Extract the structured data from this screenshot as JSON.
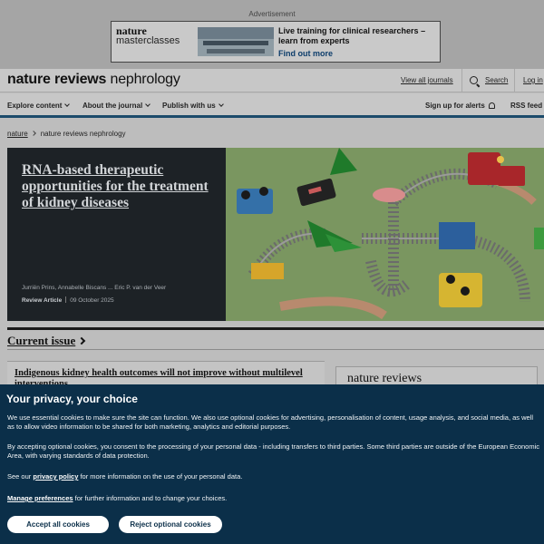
{
  "ad": {
    "label": "Advertisement",
    "brand_line1": "nature",
    "brand_line2": "masterclasses",
    "headline": "Live training for clinical researchers – learn from experts",
    "cta": "Find out more"
  },
  "header": {
    "logo_bold": "nature reviews",
    "logo_rest": " nephrology",
    "view_all": "View all journals",
    "search": "Search",
    "login": "Log in"
  },
  "nav": {
    "explore": "Explore content",
    "about": "About the journal",
    "publish": "Publish with us",
    "alerts": "Sign up for alerts",
    "rss": "RSS feed"
  },
  "breadcrumb": {
    "home": "nature",
    "current": "nature reviews nephrology"
  },
  "hero": {
    "title": "RNA-based therapeutic opportunities for the treatment of kidney diseases",
    "authors": "Jurriën Prins, Annabelle Biscans ... Eric P. van der Veer",
    "type": "Review Article",
    "date": "09 October 2025"
  },
  "current_issue": {
    "heading": "Current issue",
    "article_title": "Indigenous kidney health outcomes will not improve without multilevel interventions",
    "cover_title": "nature reviews"
  },
  "cookie": {
    "title": "Your privacy, your choice",
    "p1": "We use essential cookies to make sure the site can function. We also use optional cookies for advertising, personalisation of content, usage analysis, and social media, as well as to allow video information to be shared for both marketing, analytics and editorial purposes.",
    "p2": "By accepting optional cookies, you consent to the processing of your personal data - including transfers to third parties. Some third parties are outside of the European Economic Area, with varying standards of data protection.",
    "p3_before": "See our ",
    "p3_link": "privacy policy",
    "p3_after": " for more information on the use of your personal data.",
    "p4_link": "Manage preferences",
    "p4_after": " for further information and to change your choices.",
    "accept": "Accept all cookies",
    "reject": "Reject optional cookies"
  },
  "colors": {
    "cookie_bg": "#0b2f49",
    "nav_border": "#1c4b6b",
    "hero_bg": "#1d2226",
    "hero_image_bg": "#7a9660"
  }
}
